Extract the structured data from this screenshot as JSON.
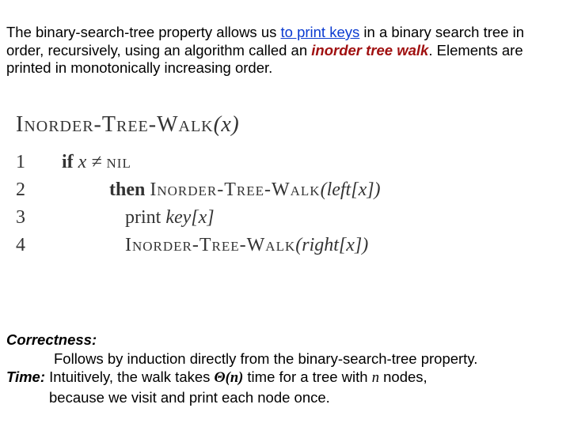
{
  "intro": {
    "t1": "The binary-search-tree property allows us ",
    "link": "to print keys",
    "t2": " in a binary search tree in order, recursively, using an algorithm called an ",
    "emph": "inorder tree walk",
    "t3": ". Elements are printed in monotonically increasing order."
  },
  "algo": {
    "name": "Inorder-Tree-Walk",
    "arg": "(x)",
    "lines": [
      {
        "n": "1",
        "indent": "i1",
        "kw": "if ",
        "body_pre": "x ≠ ",
        "nil": "nil",
        "body_post": ""
      },
      {
        "n": "2",
        "indent": "i2",
        "kw": "then ",
        "call": "Inorder-Tree-Walk",
        "carg": "(left[x])"
      },
      {
        "n": "3",
        "indent": "i2b",
        "kw": "",
        "plain_pre": "print ",
        "ital": "key[x]"
      },
      {
        "n": "4",
        "indent": "i2b",
        "kw": "",
        "call": "Inorder-Tree-Walk",
        "carg": "(right[x])"
      }
    ]
  },
  "bottom": {
    "correctness_label": "Correctness:",
    "correctness_body": "Follows by induction directly from the binary-search-tree property.",
    "time_label": "Time:",
    "time_pre": " Intuitively, the walk takes ",
    "theta": "Θ(n)",
    "time_mid": " time for a tree with ",
    "nvar": "n",
    "time_post": " nodes,",
    "time_line2": "because we visit and print each node once."
  }
}
